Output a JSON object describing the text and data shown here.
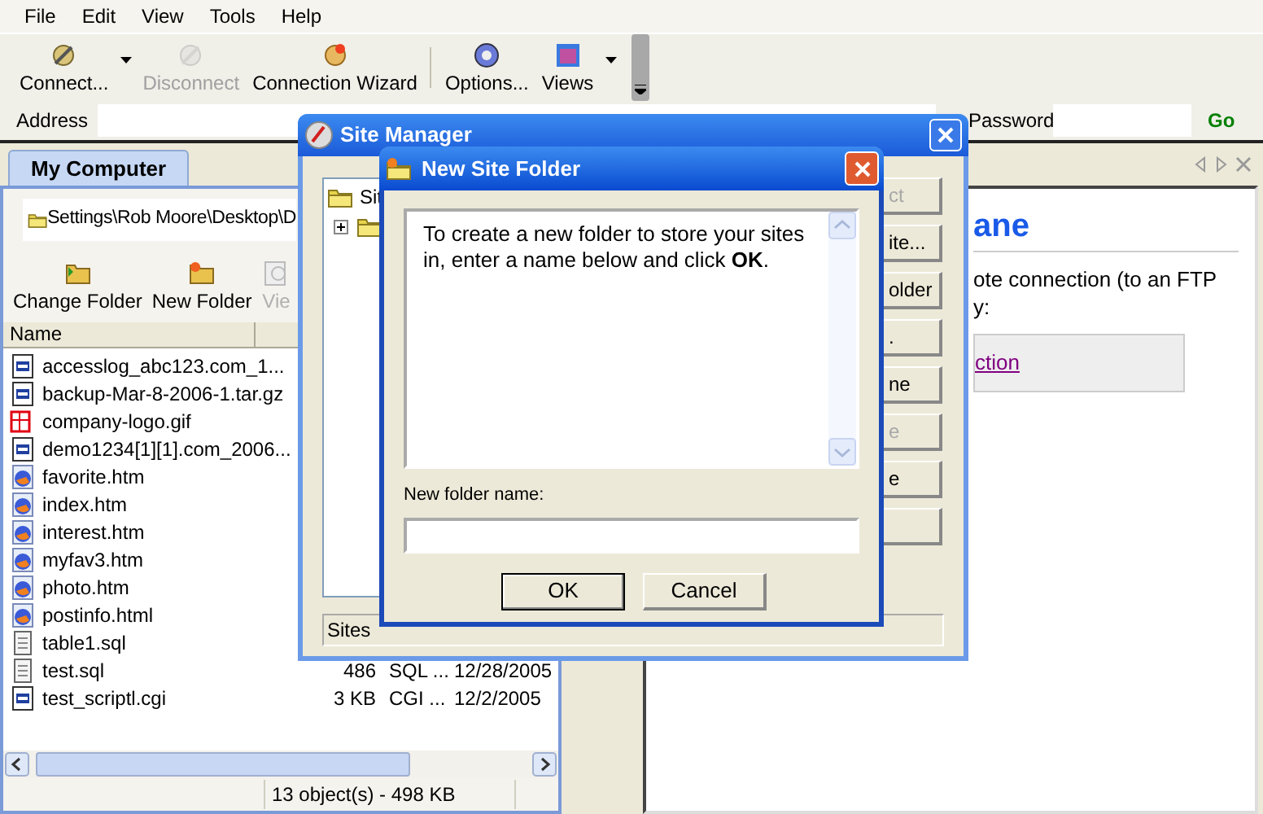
{
  "menu": [
    {
      "label": "File"
    },
    {
      "label": "Edit"
    },
    {
      "label": "View"
    },
    {
      "label": "Tools"
    },
    {
      "label": "Help"
    }
  ],
  "toolbar": [
    {
      "label": "Connect...",
      "disabled": false,
      "dropdown": true
    },
    {
      "label": "Disconnect",
      "disabled": true,
      "dropdown": false
    },
    {
      "label": "Connection Wizard",
      "disabled": false,
      "dropdown": false
    },
    {
      "label": "Options...",
      "disabled": false,
      "dropdown": false
    },
    {
      "label": "Views",
      "disabled": false,
      "dropdown": true
    }
  ],
  "address_bar": {
    "label": "Address",
    "password_label": "Password",
    "go": "Go"
  },
  "local_pane": {
    "tab": "My Computer",
    "path": "Settings\\Rob Moore\\Desktop\\D",
    "actions": [
      {
        "label": "Change Folder",
        "disabled": false
      },
      {
        "label": "New Folder",
        "disabled": false
      },
      {
        "label": "Vie",
        "disabled": true
      }
    ],
    "columns": [
      "Name"
    ],
    "files": [
      {
        "name": "accesslog_abc123.com_1...",
        "kind": "script"
      },
      {
        "name": "backup-Mar-8-2006-1.tar.gz",
        "kind": "script"
      },
      {
        "name": "company-logo.gif",
        "kind": "image"
      },
      {
        "name": "demo1234[1][1].com_2006...",
        "kind": "script"
      },
      {
        "name": "favorite.htm",
        "kind": "web"
      },
      {
        "name": "index.htm",
        "kind": "web"
      },
      {
        "name": "interest.htm",
        "kind": "web"
      },
      {
        "name": "myfav3.htm",
        "kind": "web"
      },
      {
        "name": "photo.htm",
        "kind": "web"
      },
      {
        "name": "postinfo.html",
        "kind": "web"
      },
      {
        "name": "table1.sql",
        "kind": "text"
      },
      {
        "name": "test.sql",
        "kind": "text",
        "column_2": "486",
        "column_3": "SQL ...",
        "column_4": "12/28/2005"
      },
      {
        "name": "test_scriptl.cgi",
        "kind": "script",
        "column_2": "3 KB",
        "column_3": "CGI ...",
        "column_4": "12/2/2005"
      }
    ],
    "status": "13 object(s) - 498 KB"
  },
  "remote_pane": {
    "heading": "ane",
    "text": "ote connection (to an FTP",
    "text_2": "y:",
    "link": "ction"
  },
  "site_manager": {
    "title": "Site Manager",
    "tree": [
      {
        "label": "Sit",
        "children": [
          {
            "expanded": false
          }
        ]
      }
    ],
    "buttons": [
      {
        "label": "ct",
        "disabled": true
      },
      {
        "label": "ite...",
        "disabled": false
      },
      {
        "label": "older",
        "disabled": false
      },
      {
        "label": ".",
        "disabled": false
      },
      {
        "label": "ne",
        "disabled": false
      },
      {
        "label": "e",
        "disabled": true
      },
      {
        "label": "e",
        "disabled": false
      }
    ],
    "status": "Sites"
  },
  "dialog": {
    "title": "New Site Folder",
    "message": "To create a new folder to store your sites in, enter a name below and click **OK**.",
    "field_label": "New folder name:",
    "buttons": [
      {
        "label": "OK",
        "default": true
      },
      {
        "label": "Cancel",
        "default": false
      }
    ]
  }
}
